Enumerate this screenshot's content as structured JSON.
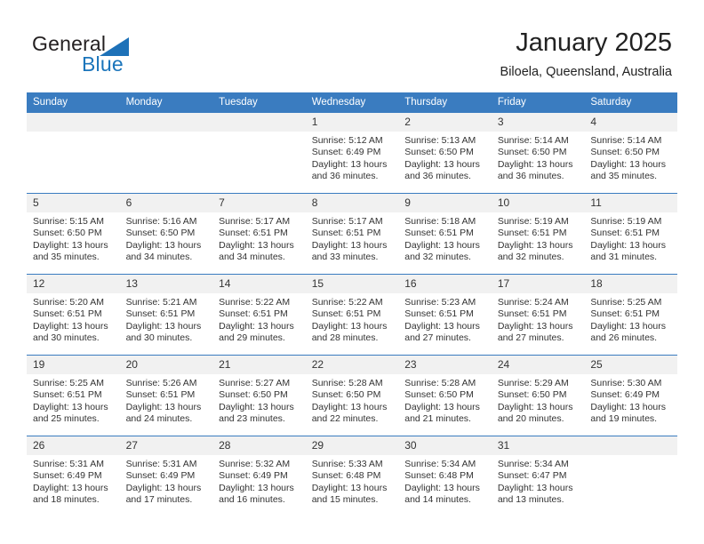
{
  "brand": {
    "name_part1": "General",
    "name_part2": "Blue",
    "logo_icon": "triangle-flag-icon",
    "accent_color": "#1b75bb"
  },
  "header": {
    "title": "January 2025",
    "subtitle": "Biloela, Queensland, Australia"
  },
  "calendar": {
    "header_bg": "#3a7cc0",
    "daynum_bg": "#f1f1f1",
    "weekday_headers": [
      "Sunday",
      "Monday",
      "Tuesday",
      "Wednesday",
      "Thursday",
      "Friday",
      "Saturday"
    ],
    "labels": {
      "sunrise": "Sunrise:",
      "sunset": "Sunset:",
      "daylight": "Daylight:"
    },
    "weeks": [
      [
        {
          "day": "",
          "blank": true
        },
        {
          "day": "",
          "blank": true
        },
        {
          "day": "",
          "blank": true
        },
        {
          "day": "1",
          "sunrise": "Sunrise: 5:12 AM",
          "sunset": "Sunset: 6:49 PM",
          "daylight_l1": "Daylight: 13 hours",
          "daylight_l2": "and 36 minutes."
        },
        {
          "day": "2",
          "sunrise": "Sunrise: 5:13 AM",
          "sunset": "Sunset: 6:50 PM",
          "daylight_l1": "Daylight: 13 hours",
          "daylight_l2": "and 36 minutes."
        },
        {
          "day": "3",
          "sunrise": "Sunrise: 5:14 AM",
          "sunset": "Sunset: 6:50 PM",
          "daylight_l1": "Daylight: 13 hours",
          "daylight_l2": "and 36 minutes."
        },
        {
          "day": "4",
          "sunrise": "Sunrise: 5:14 AM",
          "sunset": "Sunset: 6:50 PM",
          "daylight_l1": "Daylight: 13 hours",
          "daylight_l2": "and 35 minutes."
        }
      ],
      [
        {
          "day": "5",
          "sunrise": "Sunrise: 5:15 AM",
          "sunset": "Sunset: 6:50 PM",
          "daylight_l1": "Daylight: 13 hours",
          "daylight_l2": "and 35 minutes."
        },
        {
          "day": "6",
          "sunrise": "Sunrise: 5:16 AM",
          "sunset": "Sunset: 6:50 PM",
          "daylight_l1": "Daylight: 13 hours",
          "daylight_l2": "and 34 minutes."
        },
        {
          "day": "7",
          "sunrise": "Sunrise: 5:17 AM",
          "sunset": "Sunset: 6:51 PM",
          "daylight_l1": "Daylight: 13 hours",
          "daylight_l2": "and 34 minutes."
        },
        {
          "day": "8",
          "sunrise": "Sunrise: 5:17 AM",
          "sunset": "Sunset: 6:51 PM",
          "daylight_l1": "Daylight: 13 hours",
          "daylight_l2": "and 33 minutes."
        },
        {
          "day": "9",
          "sunrise": "Sunrise: 5:18 AM",
          "sunset": "Sunset: 6:51 PM",
          "daylight_l1": "Daylight: 13 hours",
          "daylight_l2": "and 32 minutes."
        },
        {
          "day": "10",
          "sunrise": "Sunrise: 5:19 AM",
          "sunset": "Sunset: 6:51 PM",
          "daylight_l1": "Daylight: 13 hours",
          "daylight_l2": "and 32 minutes."
        },
        {
          "day": "11",
          "sunrise": "Sunrise: 5:19 AM",
          "sunset": "Sunset: 6:51 PM",
          "daylight_l1": "Daylight: 13 hours",
          "daylight_l2": "and 31 minutes."
        }
      ],
      [
        {
          "day": "12",
          "sunrise": "Sunrise: 5:20 AM",
          "sunset": "Sunset: 6:51 PM",
          "daylight_l1": "Daylight: 13 hours",
          "daylight_l2": "and 30 minutes."
        },
        {
          "day": "13",
          "sunrise": "Sunrise: 5:21 AM",
          "sunset": "Sunset: 6:51 PM",
          "daylight_l1": "Daylight: 13 hours",
          "daylight_l2": "and 30 minutes."
        },
        {
          "day": "14",
          "sunrise": "Sunrise: 5:22 AM",
          "sunset": "Sunset: 6:51 PM",
          "daylight_l1": "Daylight: 13 hours",
          "daylight_l2": "and 29 minutes."
        },
        {
          "day": "15",
          "sunrise": "Sunrise: 5:22 AM",
          "sunset": "Sunset: 6:51 PM",
          "daylight_l1": "Daylight: 13 hours",
          "daylight_l2": "and 28 minutes."
        },
        {
          "day": "16",
          "sunrise": "Sunrise: 5:23 AM",
          "sunset": "Sunset: 6:51 PM",
          "daylight_l1": "Daylight: 13 hours",
          "daylight_l2": "and 27 minutes."
        },
        {
          "day": "17",
          "sunrise": "Sunrise: 5:24 AM",
          "sunset": "Sunset: 6:51 PM",
          "daylight_l1": "Daylight: 13 hours",
          "daylight_l2": "and 27 minutes."
        },
        {
          "day": "18",
          "sunrise": "Sunrise: 5:25 AM",
          "sunset": "Sunset: 6:51 PM",
          "daylight_l1": "Daylight: 13 hours",
          "daylight_l2": "and 26 minutes."
        }
      ],
      [
        {
          "day": "19",
          "sunrise": "Sunrise: 5:25 AM",
          "sunset": "Sunset: 6:51 PM",
          "daylight_l1": "Daylight: 13 hours",
          "daylight_l2": "and 25 minutes."
        },
        {
          "day": "20",
          "sunrise": "Sunrise: 5:26 AM",
          "sunset": "Sunset: 6:51 PM",
          "daylight_l1": "Daylight: 13 hours",
          "daylight_l2": "and 24 minutes."
        },
        {
          "day": "21",
          "sunrise": "Sunrise: 5:27 AM",
          "sunset": "Sunset: 6:50 PM",
          "daylight_l1": "Daylight: 13 hours",
          "daylight_l2": "and 23 minutes."
        },
        {
          "day": "22",
          "sunrise": "Sunrise: 5:28 AM",
          "sunset": "Sunset: 6:50 PM",
          "daylight_l1": "Daylight: 13 hours",
          "daylight_l2": "and 22 minutes."
        },
        {
          "day": "23",
          "sunrise": "Sunrise: 5:28 AM",
          "sunset": "Sunset: 6:50 PM",
          "daylight_l1": "Daylight: 13 hours",
          "daylight_l2": "and 21 minutes."
        },
        {
          "day": "24",
          "sunrise": "Sunrise: 5:29 AM",
          "sunset": "Sunset: 6:50 PM",
          "daylight_l1": "Daylight: 13 hours",
          "daylight_l2": "and 20 minutes."
        },
        {
          "day": "25",
          "sunrise": "Sunrise: 5:30 AM",
          "sunset": "Sunset: 6:49 PM",
          "daylight_l1": "Daylight: 13 hours",
          "daylight_l2": "and 19 minutes."
        }
      ],
      [
        {
          "day": "26",
          "sunrise": "Sunrise: 5:31 AM",
          "sunset": "Sunset: 6:49 PM",
          "daylight_l1": "Daylight: 13 hours",
          "daylight_l2": "and 18 minutes."
        },
        {
          "day": "27",
          "sunrise": "Sunrise: 5:31 AM",
          "sunset": "Sunset: 6:49 PM",
          "daylight_l1": "Daylight: 13 hours",
          "daylight_l2": "and 17 minutes."
        },
        {
          "day": "28",
          "sunrise": "Sunrise: 5:32 AM",
          "sunset": "Sunset: 6:49 PM",
          "daylight_l1": "Daylight: 13 hours",
          "daylight_l2": "and 16 minutes."
        },
        {
          "day": "29",
          "sunrise": "Sunrise: 5:33 AM",
          "sunset": "Sunset: 6:48 PM",
          "daylight_l1": "Daylight: 13 hours",
          "daylight_l2": "and 15 minutes."
        },
        {
          "day": "30",
          "sunrise": "Sunrise: 5:34 AM",
          "sunset": "Sunset: 6:48 PM",
          "daylight_l1": "Daylight: 13 hours",
          "daylight_l2": "and 14 minutes."
        },
        {
          "day": "31",
          "sunrise": "Sunrise: 5:34 AM",
          "sunset": "Sunset: 6:47 PM",
          "daylight_l1": "Daylight: 13 hours",
          "daylight_l2": "and 13 minutes."
        },
        {
          "day": "",
          "blank": true
        }
      ]
    ]
  }
}
